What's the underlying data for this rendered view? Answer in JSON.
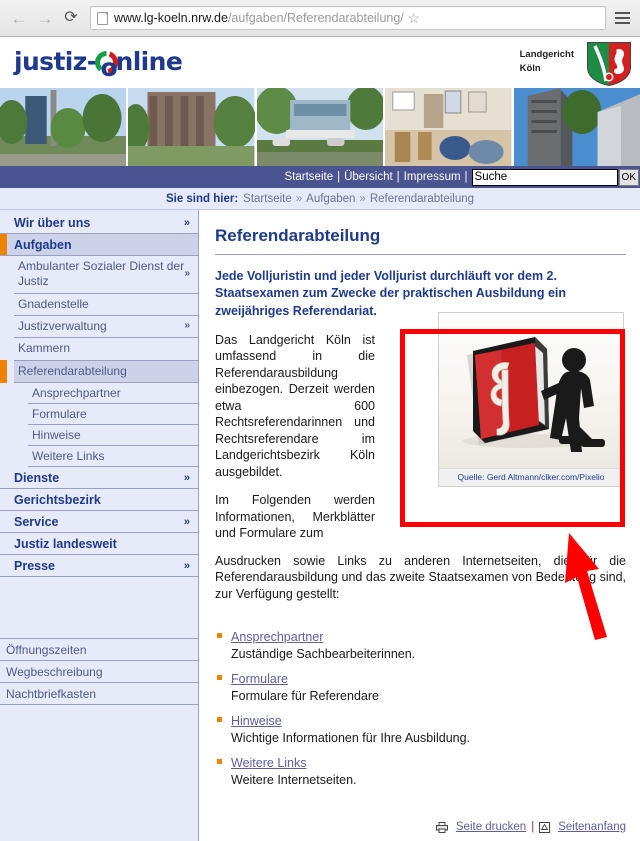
{
  "browser": {
    "back_icon": "back-arrow-icon",
    "forward_icon": "forward-arrow-icon",
    "reload_icon": "reload-icon",
    "url_domain": "www.lg-koeln.nrw.de",
    "url_path": "/aufgaben/Referendarabteilung/",
    "bookmark_icon": "star-icon",
    "menu_icon": "hamburger-menu-icon"
  },
  "header": {
    "logo_before": "justiz",
    "logo_dash": "-",
    "logo_after": "nline",
    "logo_o": "o",
    "court_line1": "Landgericht",
    "court_line2": "Köln",
    "coat_of_arms": "nrw-coat-of-arms-icon"
  },
  "navbar": {
    "links": [
      "Startseite",
      "Übersicht",
      "Impressum"
    ],
    "separator": "|",
    "search_value": "Suche",
    "search_placeholder": "Suche",
    "ok_label": "OK"
  },
  "breadcrumb": {
    "lead": "Sie sind hier:",
    "items": [
      "Startseite",
      "Aufgaben",
      "Referendarabteilung"
    ],
    "arrow": "»"
  },
  "sidebar": {
    "top_items": [
      {
        "label": "Wir über uns",
        "chevron": "»",
        "active": false
      },
      {
        "label": "Aufgaben",
        "chevron": "",
        "active": true
      }
    ],
    "sub_items": [
      {
        "label": "Ambulanter Sozialer Dienst der Justiz",
        "chevron": "»",
        "active": false
      },
      {
        "label": "Gnadenstelle",
        "chevron": "",
        "active": false
      },
      {
        "label": "Justizverwaltung",
        "chevron": "»",
        "active": false
      },
      {
        "label": "Kammern",
        "chevron": "",
        "active": false
      },
      {
        "label": "Referendarabteilung",
        "chevron": "",
        "active": true
      }
    ],
    "sub_sub_items": [
      "Ansprechpartner",
      "Formulare",
      "Hinweise",
      "Weitere Links"
    ],
    "bottom_items": [
      {
        "label": "Dienste",
        "chevron": "»"
      },
      {
        "label": "Gerichtsbezirk",
        "chevron": ""
      },
      {
        "label": "Service",
        "chevron": "»"
      },
      {
        "label": "Justiz landesweit",
        "chevron": ""
      },
      {
        "label": "Presse",
        "chevron": "»"
      }
    ],
    "plain_items": [
      "Öffnungszeiten",
      "Wegbeschreibung",
      "Nachtbriefkasten"
    ]
  },
  "main": {
    "title": "Referendarabteilung",
    "lead": "Jede Volljuristin und jeder Volljurist durchläuft vor dem 2. Staatsexamen zum Zwecke der praktischen Ausbildung ein zweijähriges Referendariat.",
    "para1": "Das Landgericht Köln ist umfassend in die Referendarausbildung einbezogen. Derzeit werden etwa 600 Rechtsreferendarinnen und Rechtsreferendare im Landgerichtsbezirk Köln ausgebildet.",
    "para2_col": "Im Folgenden werden Informationen, Merkblätter und Formulare zum",
    "para2_full": "Ausdrucken sowie Links zu anderen Internetseiten, die für die Referendarausbildung und das zweite Staatsexamen von Bedeutung sind, zur Verfügung gestellt:",
    "figure_caption": "Quelle: Gerd Altmann/clker.com/Pixelio",
    "figure_alt": "paragraph-book-icon",
    "links": [
      {
        "label": "Ansprechpartner",
        "desc": "Zuständige Sachbearbeiterinnen."
      },
      {
        "label": "Formulare",
        "desc": "Formulare für Referendare"
      },
      {
        "label": "Hinweise",
        "desc": "Wichtige Informationen für Ihre Ausbildung."
      },
      {
        "label": "Weitere Links",
        "desc": "Weitere Internetseiten."
      }
    ]
  },
  "footer": {
    "print_label": "Seite drucken",
    "print_icon": "printer-icon",
    "separator": "|",
    "top_label": "Seitenanfang",
    "top_icon": "up-arrow-box-icon"
  },
  "annotation": {
    "box_color": "#fd0000",
    "arrow_color": "#fd0000"
  }
}
